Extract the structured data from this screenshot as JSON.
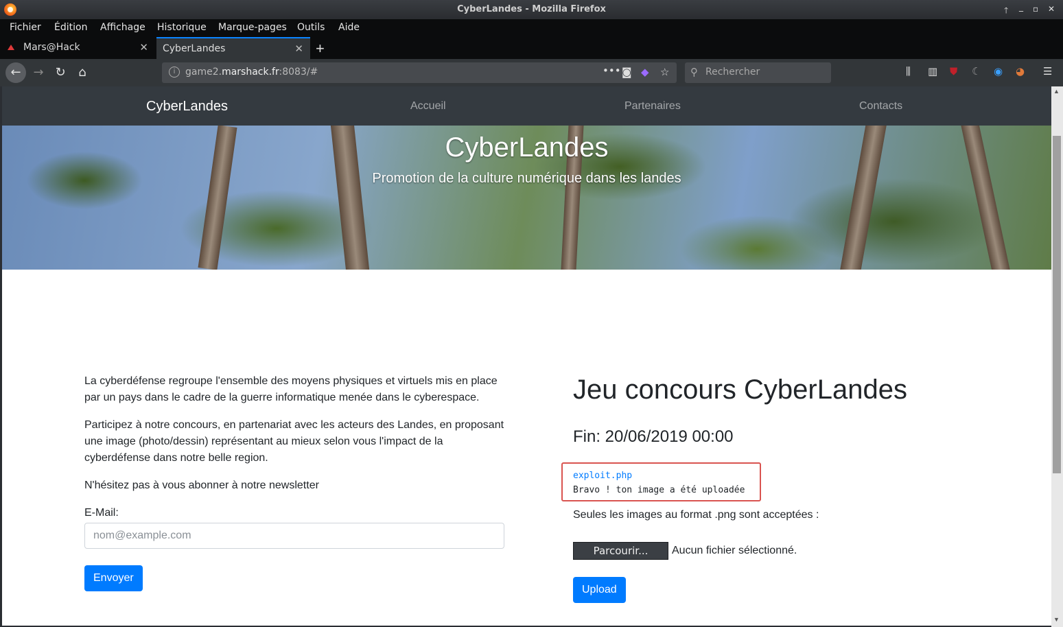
{
  "window": {
    "title": "CyberLandes - Mozilla Firefox",
    "controls": [
      "🡑",
      "_",
      "▫",
      "✕"
    ]
  },
  "menu": [
    "Fichier",
    "Édition",
    "Affichage",
    "Historique",
    "Marque-pages",
    "Outils",
    "Aide"
  ],
  "tabs": [
    {
      "label": "Mars@Hack",
      "active": false
    },
    {
      "label": "CyberLandes",
      "active": true
    }
  ],
  "url": {
    "pre": "game2.",
    "domain": "marshack.fr",
    "post": ":8083/#"
  },
  "search": {
    "placeholder": "Rechercher"
  },
  "site": {
    "brand": "CyberLandes",
    "nav": [
      "Accueil",
      "Partenaires",
      "Contacts"
    ],
    "hero_title": "CyberLandes",
    "hero_subtitle": "Promotion de la culture numérique dans les landes"
  },
  "left": {
    "p1": "La cyberdéfense regroupe l'ensemble des moyens physiques et virtuels mis en place par un pays dans le cadre de la guerre informatique menée dans le cyberespace.",
    "p2": "Participez à notre concours, en partenariat avec les acteurs des Landes, en proposant une image (photo/dessin) représentant au mieux selon vous l'impact de la cyberdéfense dans notre belle region.",
    "p3": "N'hésitez pas à vous abonner à notre newsletter",
    "email_label": "E-Mail:",
    "email_placeholder": "nom@example.com",
    "submit": "Envoyer"
  },
  "right": {
    "title": "Jeu concours CyberLandes",
    "deadline": "Fin: 20/06/2019 00:00",
    "result_file": "exploit.php",
    "result_msg": "Bravo ! ton image a été uploadée",
    "accept": "Seules les images au format .png sont acceptées :",
    "browse": "Parcourir...",
    "nofile": "Aucun fichier sélectionné.",
    "upload": "Upload"
  }
}
